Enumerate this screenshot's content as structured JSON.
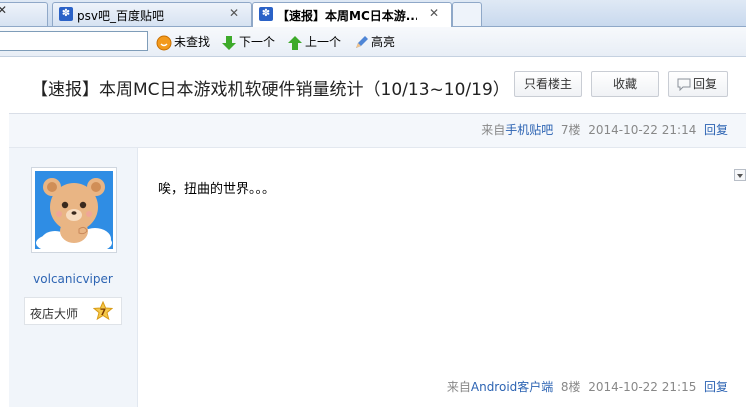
{
  "tabs": [
    {
      "title": "psv吧_百度贴吧",
      "close": "✕"
    },
    {
      "title": "【速报】本周MC日本游...",
      "close": "✕"
    }
  ],
  "findbar": {
    "search_value": "",
    "not_found": "未查找",
    "next": "下一个",
    "prev": "上一个",
    "highlight": "高亮"
  },
  "thread": {
    "title": "【速报】本周MC日本游戏机软硬件销量统计（10/13~10/19）",
    "only_op": "只看楼主",
    "favorite": "收藏",
    "reply": "回复"
  },
  "posts": [
    {
      "source_prefix": "来自",
      "source_link": "手机贴吧",
      "floor": "7楼",
      "time": "2014-10-22 21:14",
      "reply": "回复"
    },
    {
      "username": "volcanicviper",
      "rank_title": "夜店大师",
      "level": "7",
      "content": "唉，扭曲的世界。。。",
      "source_prefix": "来自",
      "source_link": "Android客户端",
      "floor": "8楼",
      "time": "2014-10-22 21:15",
      "reply": "回复"
    }
  ],
  "colors": {
    "link": "#2d64b3",
    "tab_active_bg": "#ffffff",
    "tab_bar": "#c9d9ee"
  },
  "icons": [
    "paw-icon",
    "close-icon",
    "orange-circle-icon",
    "down-arrow-icon",
    "up-arrow-icon",
    "pencil-icon",
    "reply-bubble-icon",
    "level-star-icon"
  ]
}
